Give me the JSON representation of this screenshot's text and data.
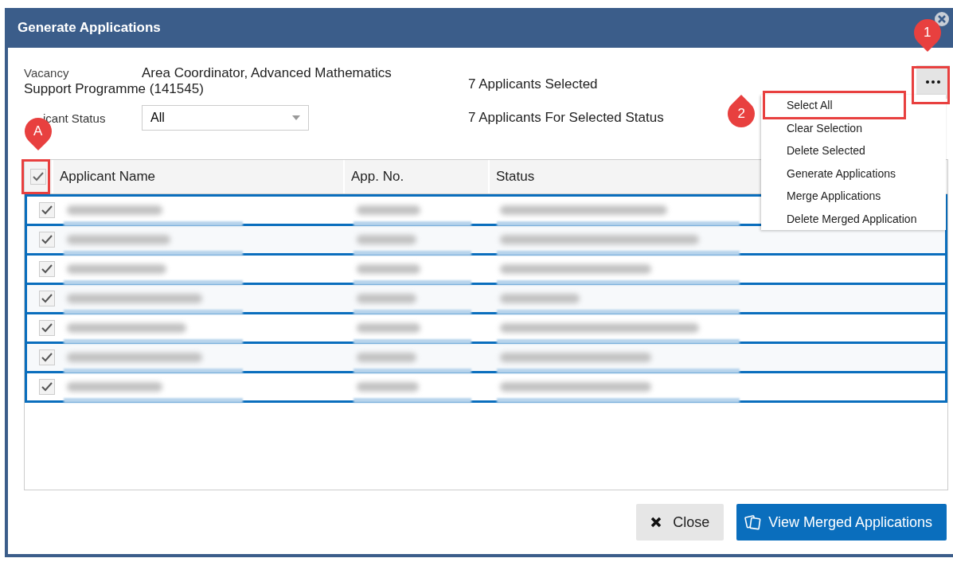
{
  "window": {
    "title": "Generate Applications"
  },
  "vacancy": {
    "label": "Vacancy",
    "value": "Area Coordinator, Advanced Mathematics Support Programme (141545)"
  },
  "applicant_status": {
    "label": "icant Status",
    "value": "All"
  },
  "counts": [
    "7 Applicants Selected",
    "7 Applicants For Selected Status"
  ],
  "menu": [
    "Select All",
    "Clear Selection",
    "Delete Selected",
    "Generate Applications",
    "Merge Applications",
    "Delete Merged Application"
  ],
  "annotations": [
    {
      "label": "1",
      "kind": "more"
    },
    {
      "label": "2",
      "kind": "menu"
    },
    {
      "label": "A",
      "kind": "checkbox"
    }
  ],
  "table": {
    "select_all_checked": true,
    "columns": [
      "Applicant Name",
      "App. No.",
      "Status"
    ],
    "rows": [
      {
        "checked": true
      },
      {
        "checked": true
      },
      {
        "checked": true
      },
      {
        "checked": true
      },
      {
        "checked": true
      },
      {
        "checked": true
      },
      {
        "checked": true
      }
    ]
  },
  "buttons": [
    {
      "kind": "close",
      "label": "Close"
    },
    {
      "kind": "primary",
      "label": "View Merged Applications"
    }
  ]
}
